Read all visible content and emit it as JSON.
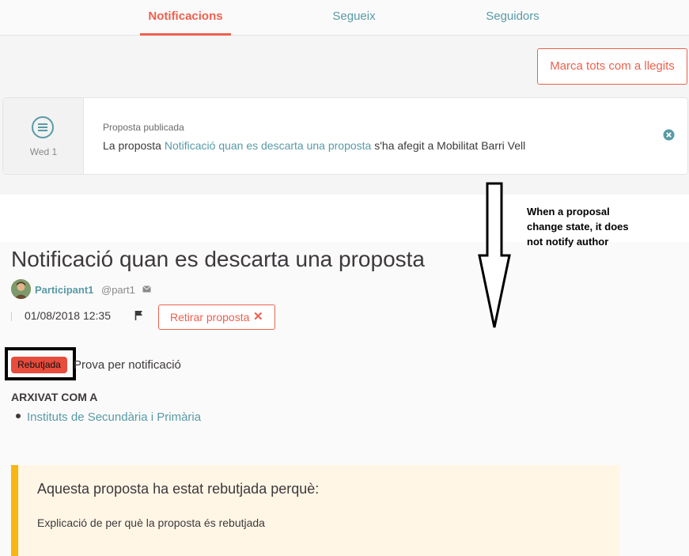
{
  "tabs": [
    {
      "label": "Notificacions",
      "active": true
    },
    {
      "label": "Segueix",
      "active": false
    },
    {
      "label": "Seguidors",
      "active": false
    }
  ],
  "mark_all_label": "Marca tots com a llegits",
  "notification": {
    "date": "Wed 1",
    "type": "Proposta publicada",
    "text_before": "La proposta ",
    "link_text": "Notificació quan es descarta una proposta",
    "text_after": " s'ha afegit a Mobilitat Barri Vell",
    "icon": "proposal-list-icon"
  },
  "annotation": {
    "lines": [
      "When a proposal",
      "change state, it does",
      "not notify author"
    ]
  },
  "proposal": {
    "title": "Notificació quan es descarta una proposta",
    "author_name": "Participant1",
    "author_nick": "@part1",
    "date": "01/08/2018 12:35",
    "withdraw_label": "Retirar proposta",
    "withdraw_icon": "✕",
    "state_badge": "Rebutjada",
    "body": "Prova per notificació",
    "archived_label": "ARXIVAT COM A",
    "archived_items": [
      "Instituts de Secundària i Primària"
    ],
    "callout_title": "Aquesta proposta ha estat rebutjada perquè:",
    "callout_body": "Explicació de per què la proposta és rebutjada"
  },
  "colors": {
    "accent": "#ef604d",
    "link": "#599aa6",
    "badge": "#e74c3c",
    "warning": "#f7b611"
  }
}
